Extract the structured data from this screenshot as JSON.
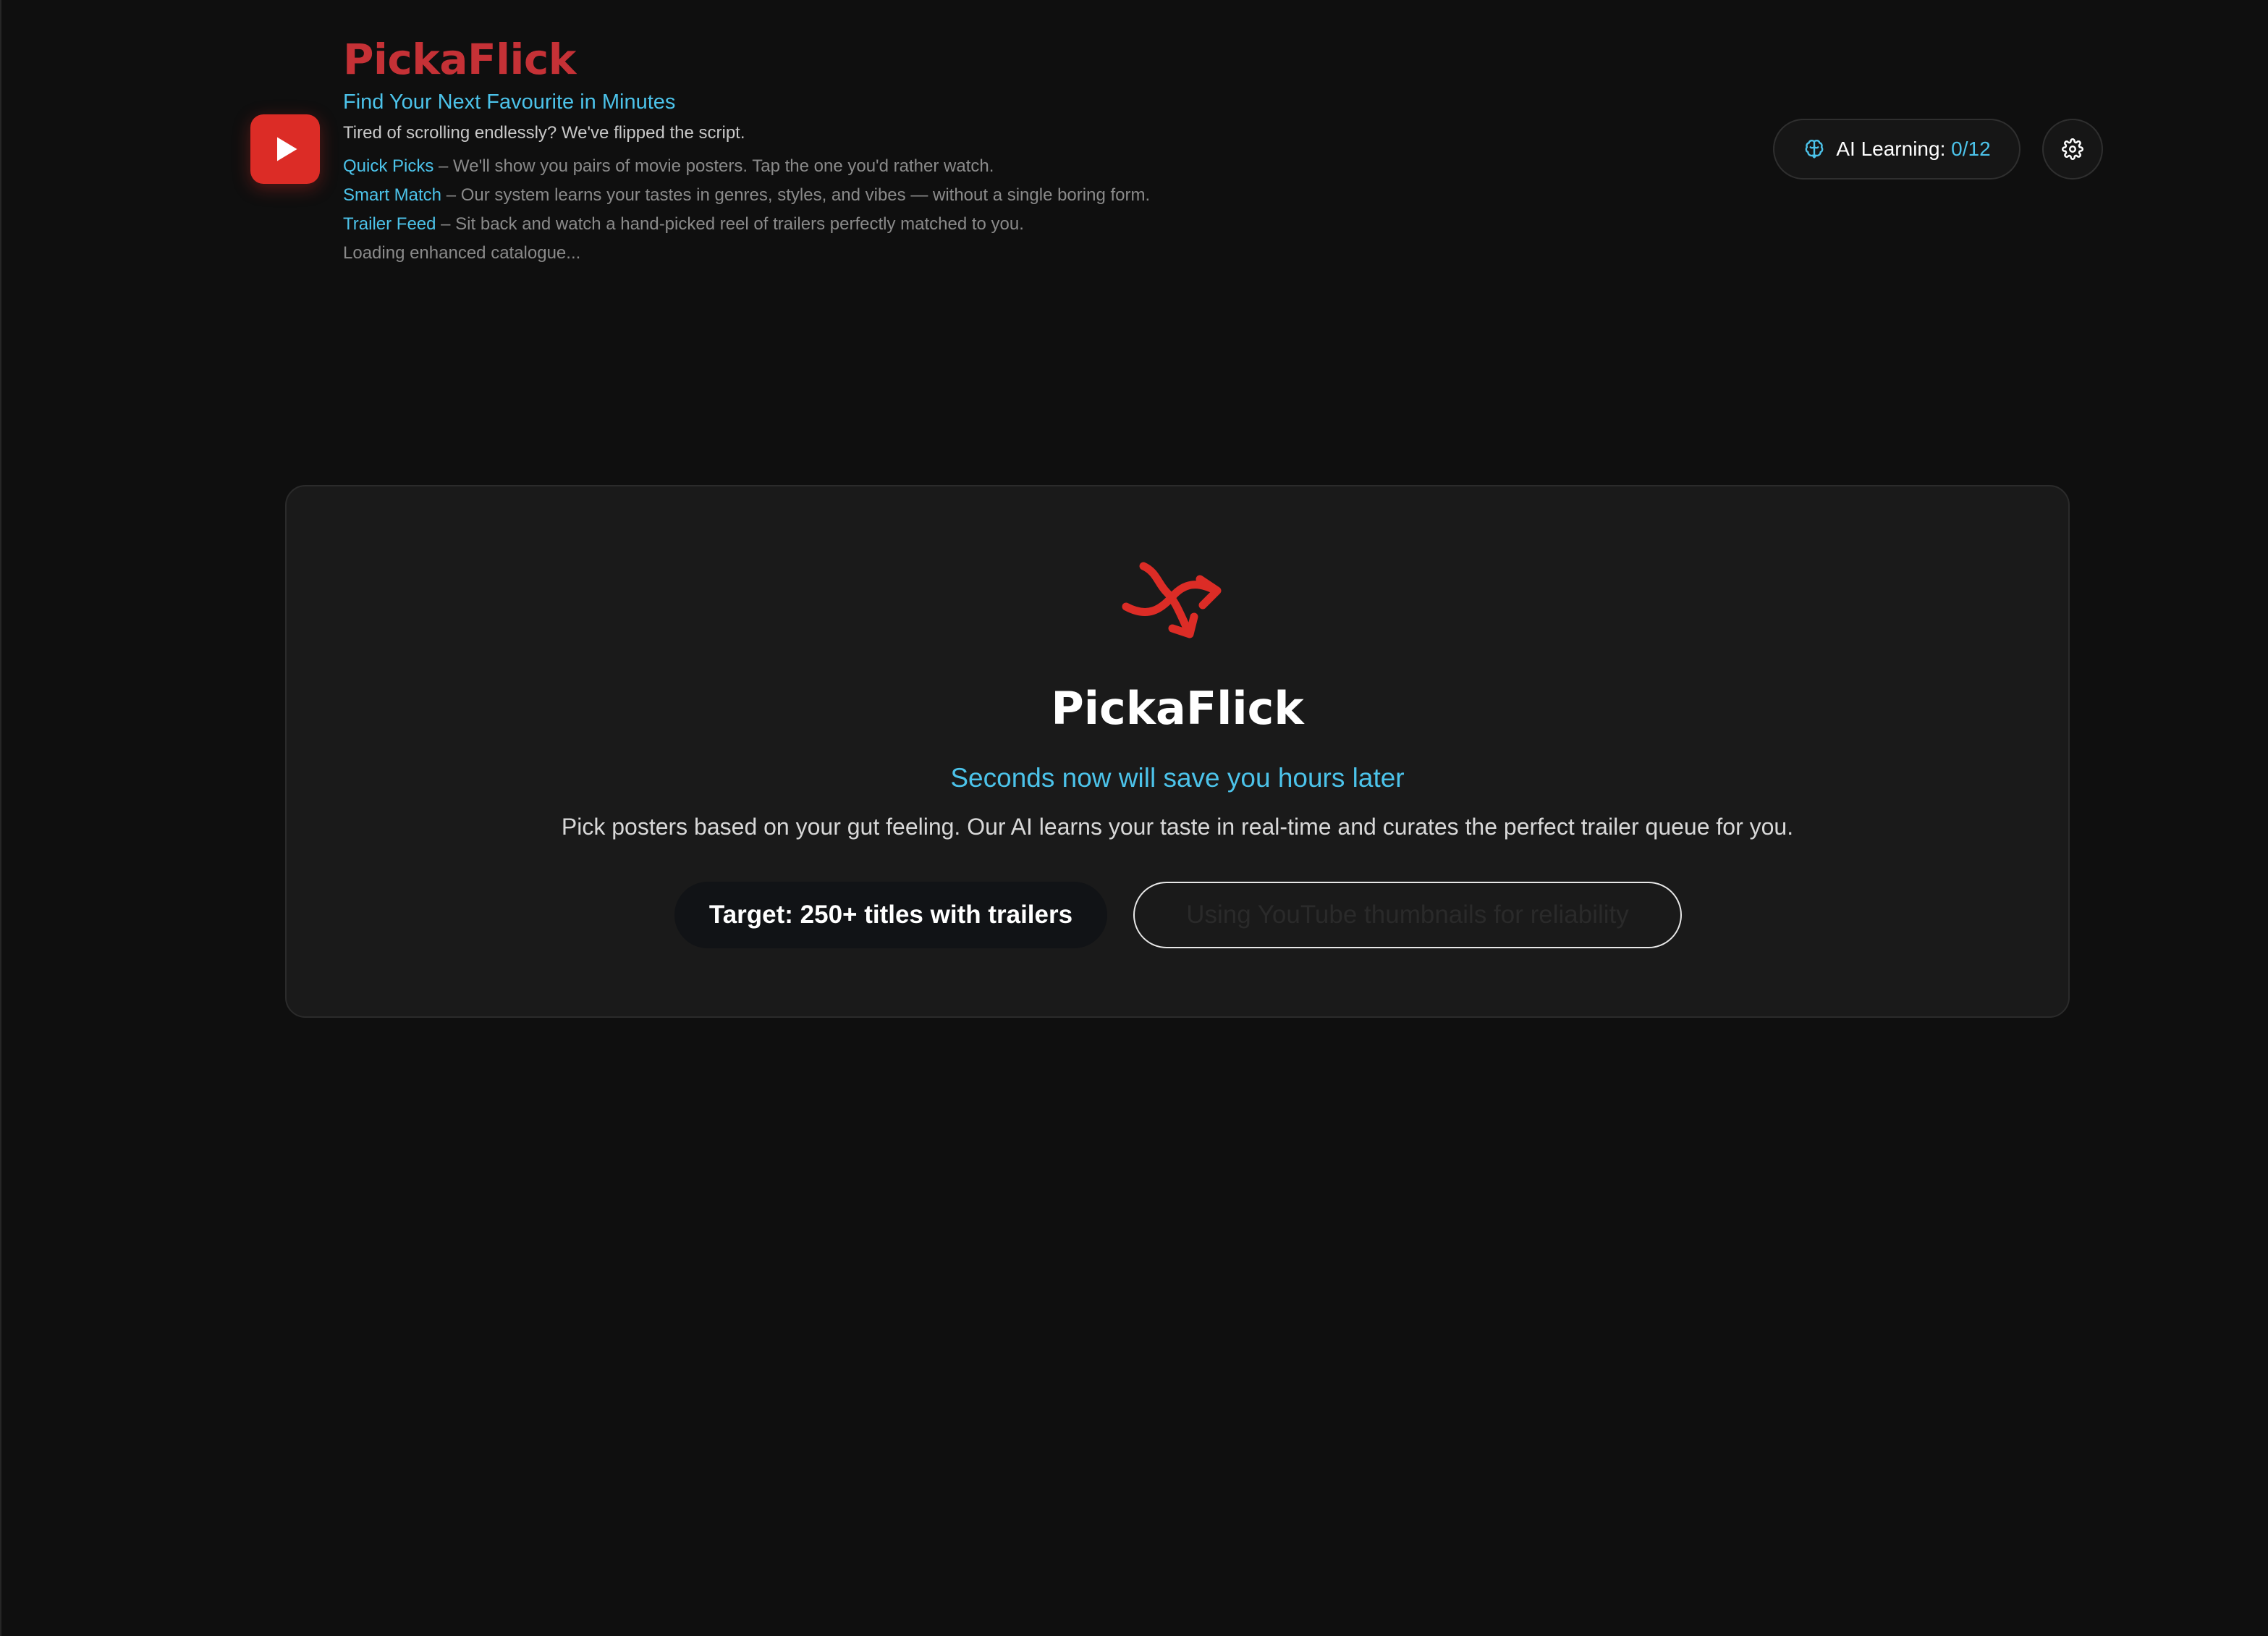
{
  "header": {
    "title": "PickaFlick",
    "tagline": "Find Your Next Favourite in Minutes",
    "intro": "Tired of scrolling endlessly? We've flipped the script.",
    "features": [
      {
        "name": "Quick Picks",
        "desc": " – We'll show you pairs of movie posters. Tap the one you'd rather watch."
      },
      {
        "name": "Smart Match",
        "desc": " – Our system learns your tastes in genres, styles, and vibes — without a single boring form."
      },
      {
        "name": "Trailer Feed",
        "desc": " – Sit back and watch a hand-picked reel of trailers perfectly matched to you."
      }
    ],
    "loading": "Loading enhanced catalogue...",
    "ai_label": "AI Learning: ",
    "ai_count": "0/12"
  },
  "card": {
    "title": "PickaFlick",
    "subtitle": "Seconds now will save you hours later",
    "description": "Pick posters based on your gut feeling. Our AI learns your taste in real-time and curates the perfect trailer queue for you.",
    "badge_target": "Target: 250+ titles with trailers",
    "badge_source": "Using YouTube thumbnails for reliability"
  },
  "colors": {
    "accent_red": "#dc2c26",
    "accent_cyan": "#4cc3ea",
    "background": "#0f0f0f",
    "card": "#1a1a1a"
  },
  "icons": {
    "logo": "play-icon",
    "ai": "brain-icon",
    "settings": "gear-icon",
    "card": "shuffle-icon"
  }
}
